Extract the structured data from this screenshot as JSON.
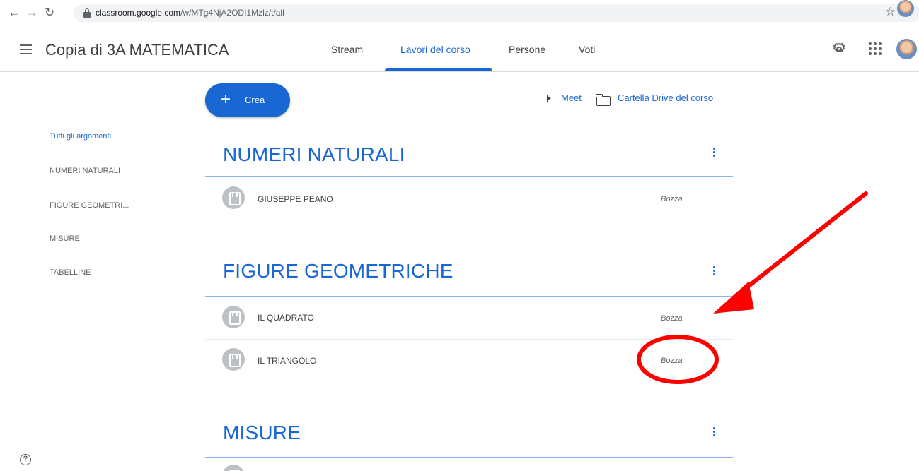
{
  "browser": {
    "back_icon": "arrow-left-icon",
    "forward_icon": "arrow-right-icon",
    "reload_icon": "reload-icon",
    "url_host": "classroom.google.com",
    "url_path": "/w/MTg4NjA2ODI1Mzlz/t/all",
    "bookmark_icon": "star-icon"
  },
  "header": {
    "course_title": "Copia di 3A MATEMATICA",
    "tabs": [
      {
        "label": "Stream"
      },
      {
        "label": "Lavori del corso",
        "active": true
      },
      {
        "label": "Persone"
      },
      {
        "label": "Voti"
      }
    ]
  },
  "toolbar": {
    "create_label": "Crea",
    "meet_label": "Meet",
    "drive_label": "Cartella Drive del corso"
  },
  "topics_nav": [
    {
      "label": "Tutti gli argomenti",
      "active": true
    },
    {
      "label": "NUMERI NATURALI"
    },
    {
      "label": "FIGURE GEOMETRI..."
    },
    {
      "label": "MISURE"
    },
    {
      "label": "TABELLINE"
    }
  ],
  "sections": [
    {
      "title": "NUMERI NATURALI",
      "items": [
        {
          "title": "GIUSEPPE PEANO",
          "status": "Bozza"
        }
      ]
    },
    {
      "title": "FIGURE GEOMETRICHE",
      "items": [
        {
          "title": "IL QUADRATO",
          "status": "Bozza"
        },
        {
          "title": "IL TRIANGOLO",
          "status": "Bozza"
        }
      ]
    },
    {
      "title": "MISURE",
      "items": []
    }
  ],
  "annotations": {
    "color": "#ff0000"
  },
  "help_icon_text": "?"
}
